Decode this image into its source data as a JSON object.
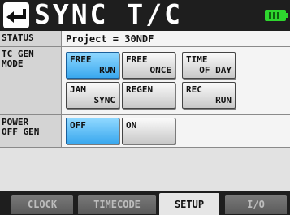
{
  "header": {
    "title": "SYNC T/C",
    "back_icon": "back-arrow-icon",
    "battery_icon": "battery-icon",
    "battery_color": "#2ed62e"
  },
  "status": {
    "label": "STATUS",
    "value": "Project = 30NDF"
  },
  "tc_gen_mode": {
    "label_line1": "TC GEN",
    "label_line2": "MODE",
    "buttons": [
      {
        "line1": "FREE",
        "line2": "RUN",
        "selected": true
      },
      {
        "line1": "FREE",
        "line2": "ONCE",
        "selected": false
      },
      {
        "line1": "TIME",
        "line2": "OF DAY",
        "selected": false
      },
      {
        "line1": "JAM",
        "line2": "SYNC",
        "selected": false
      },
      {
        "line1": "REGEN",
        "line2": "",
        "selected": false
      },
      {
        "line1": "REC",
        "line2": "RUN",
        "selected": false
      }
    ]
  },
  "power_off_gen": {
    "label_line1": "POWER",
    "label_line2": "OFF GEN",
    "buttons": [
      {
        "line1": "OFF",
        "selected": true
      },
      {
        "line1": "ON",
        "selected": false
      }
    ]
  },
  "tabs": [
    {
      "label": "CLOCK",
      "active": false
    },
    {
      "label": "TIMECODE",
      "active": false
    },
    {
      "label": "SETUP",
      "active": true
    },
    {
      "label": "I/O",
      "active": false
    }
  ],
  "colors": {
    "selected_button": "#3aa8ee",
    "title_bar": "#1e1e1e"
  }
}
